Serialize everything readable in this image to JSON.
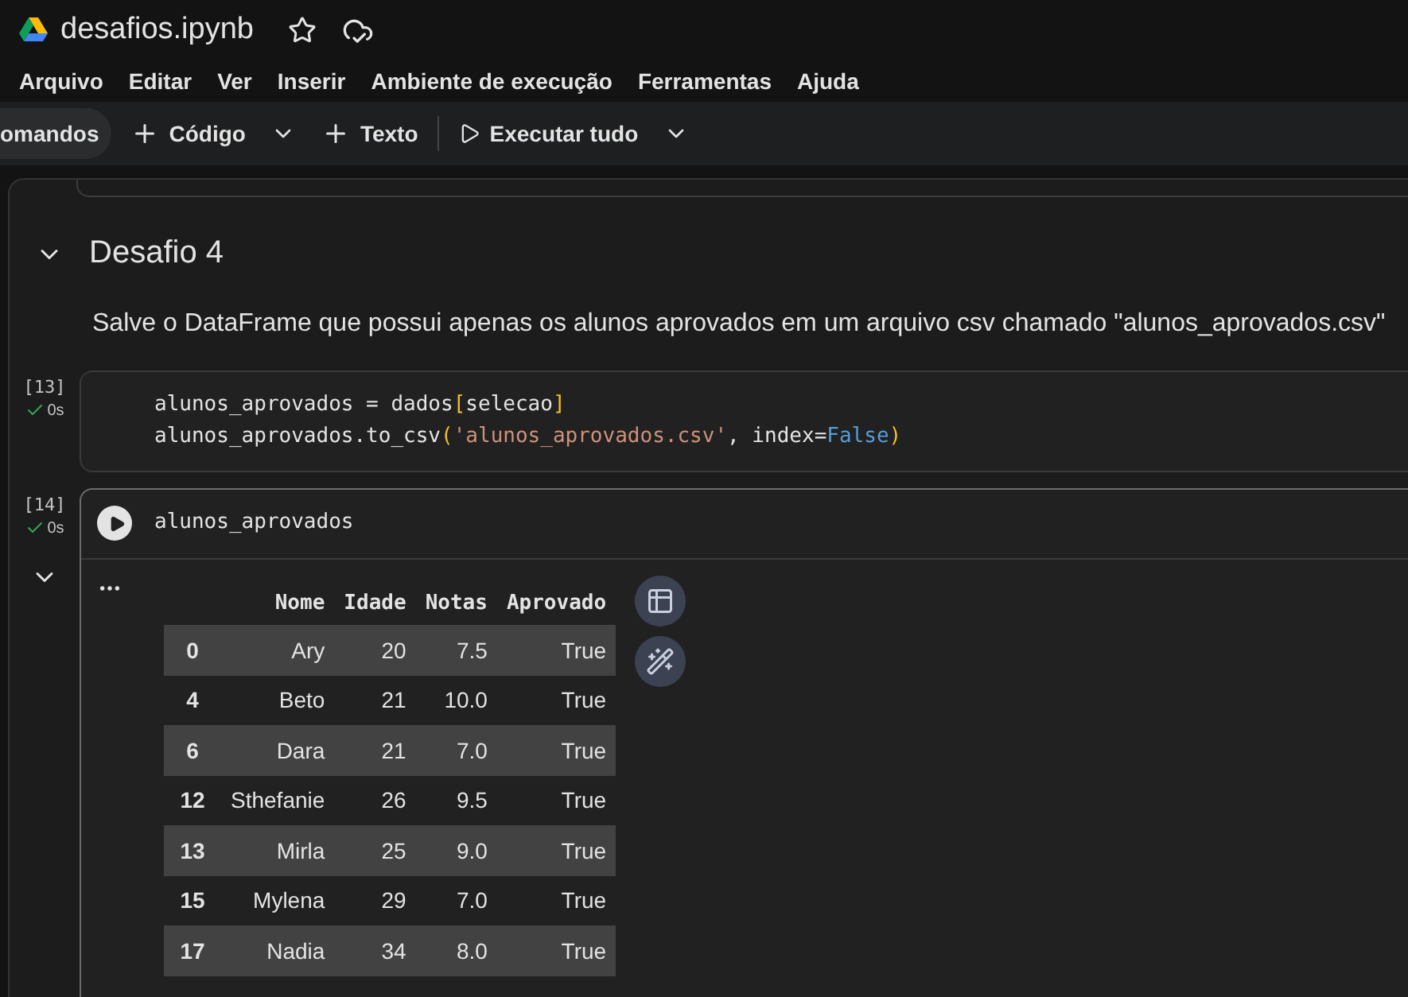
{
  "window": {
    "title": "desafios.ipynb"
  },
  "menu": [
    "Arquivo",
    "Editar",
    "Ver",
    "Inserir",
    "Ambiente de execução",
    "Ferramentas",
    "Ajuda"
  ],
  "toolbar": {
    "commands": "omandos",
    "add_code": "Código",
    "add_text": "Texto",
    "run_all": "Executar tudo"
  },
  "section": {
    "title": "Desafio 4",
    "expanded": true,
    "text": "Salve o DataFrame que possui apenas os alunos aprovados em um arquivo csv chamado \"alunos_aprovados.csv\""
  },
  "cells": [
    {
      "count": "[13]",
      "time": "0s",
      "focused": false,
      "lines": [
        [
          {
            "kind": "plain",
            "text": "alunos_aprovados = dados"
          },
          {
            "kind": "bracket",
            "text": "["
          },
          {
            "kind": "plain",
            "text": "selecao"
          },
          {
            "kind": "bracket",
            "text": "]"
          }
        ],
        [
          {
            "kind": "plain",
            "text": "alunos_aprovados.to_csv"
          },
          {
            "kind": "bracket",
            "text": "("
          },
          {
            "kind": "string",
            "text": "'alunos_aprovados.csv'"
          },
          {
            "kind": "plain",
            "text": ", index="
          },
          {
            "kind": "keyword",
            "text": "False"
          },
          {
            "kind": "bracket",
            "text": ")"
          }
        ]
      ]
    },
    {
      "count": "[14]",
      "time": "0s",
      "focused": true,
      "lines": [
        [
          {
            "kind": "plain",
            "text": "alunos_aprovados"
          }
        ]
      ],
      "output": {
        "columns": [
          "",
          "Nome",
          "Idade",
          "Notas",
          "Aprovado"
        ],
        "rows": [
          [
            "0",
            "Ary",
            "20",
            "7.5",
            "True"
          ],
          [
            "4",
            "Beto",
            "21",
            "10.0",
            "True"
          ],
          [
            "6",
            "Dara",
            "21",
            "7.0",
            "True"
          ],
          [
            "12",
            "Sthefanie",
            "26",
            "9.5",
            "True"
          ],
          [
            "13",
            "Mirla",
            "25",
            "9.0",
            "True"
          ],
          [
            "15",
            "Mylena",
            "29",
            "7.0",
            "True"
          ],
          [
            "17",
            "Nadia",
            "34",
            "8.0",
            "True"
          ]
        ]
      }
    }
  ]
}
